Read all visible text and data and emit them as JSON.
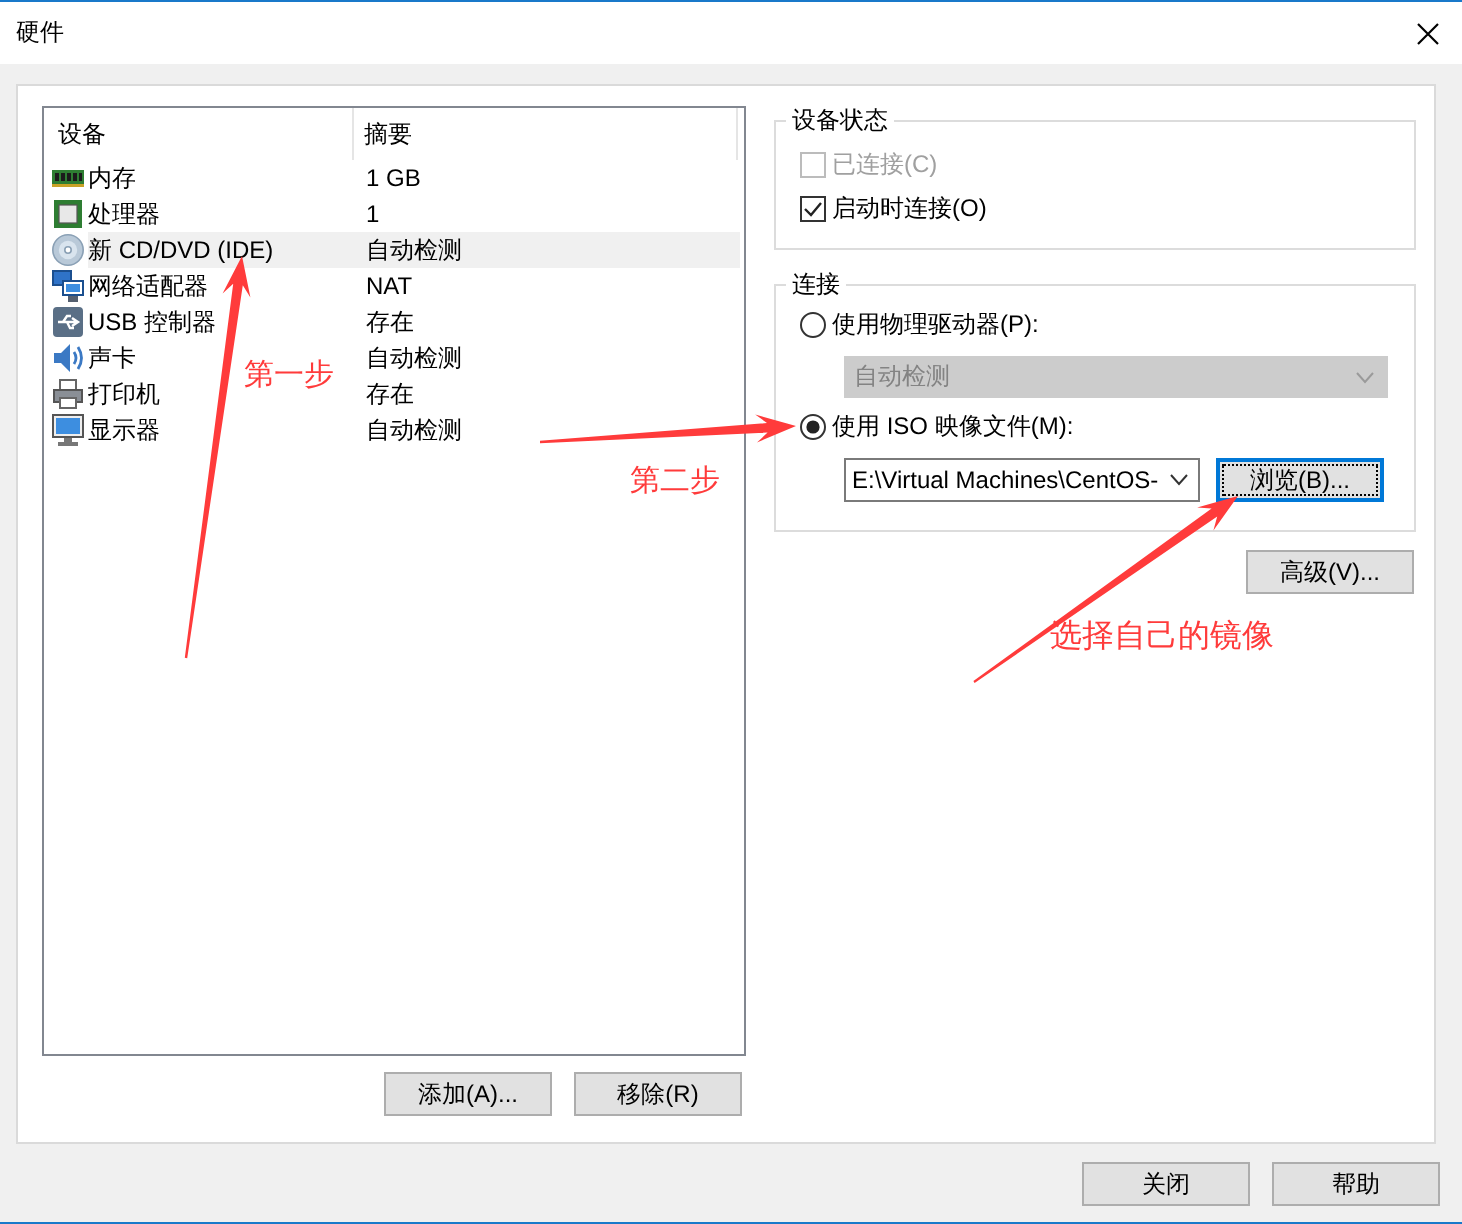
{
  "window": {
    "title": "硬件"
  },
  "devices": {
    "columns": [
      "设备",
      "摘要"
    ],
    "rows": [
      {
        "kind": "memory",
        "name": "内存",
        "summary": "1 GB",
        "selected": false
      },
      {
        "kind": "processor",
        "name": "处理器",
        "summary": "1",
        "selected": false
      },
      {
        "kind": "cdrom",
        "name": "新 CD/DVD (IDE)",
        "summary": "自动检测",
        "selected": true
      },
      {
        "kind": "network",
        "name": "网络适配器",
        "summary": "NAT",
        "selected": false
      },
      {
        "kind": "usb",
        "name": "USB 控制器",
        "summary": "存在",
        "selected": false
      },
      {
        "kind": "sound",
        "name": "声卡",
        "summary": "自动检测",
        "selected": false
      },
      {
        "kind": "printer",
        "name": "打印机",
        "summary": "存在",
        "selected": false
      },
      {
        "kind": "display",
        "name": "显示器",
        "summary": "自动检测",
        "selected": false
      }
    ]
  },
  "device_buttons": [
    "添加(A)...",
    "移除(R)"
  ],
  "device_status": {
    "title": "设备状态",
    "options": [
      {
        "label": "已连接(C)",
        "checked": false,
        "disabled": true
      },
      {
        "label": "启动时连接(O)",
        "checked": true,
        "disabled": false
      }
    ]
  },
  "connection": {
    "title": "连接",
    "options": [
      {
        "kind": "drive",
        "label": "使用物理驱动器(P):",
        "selected": false,
        "dropdown": {
          "value": "自动检测",
          "disabled": true
        }
      },
      {
        "kind": "image",
        "label": "使用 ISO 映像文件(M):",
        "selected": true,
        "path": {
          "value": "E:\\Virtual Machines\\CentOS-"
        },
        "browse": {
          "label": "浏览(B)...",
          "focused": true
        }
      }
    ]
  },
  "advanced_button": "高级(V)...",
  "footer_buttons": [
    "关闭",
    "帮助"
  ],
  "annotations": [
    "第一步",
    "第二步",
    "选择自己的镜像"
  ]
}
